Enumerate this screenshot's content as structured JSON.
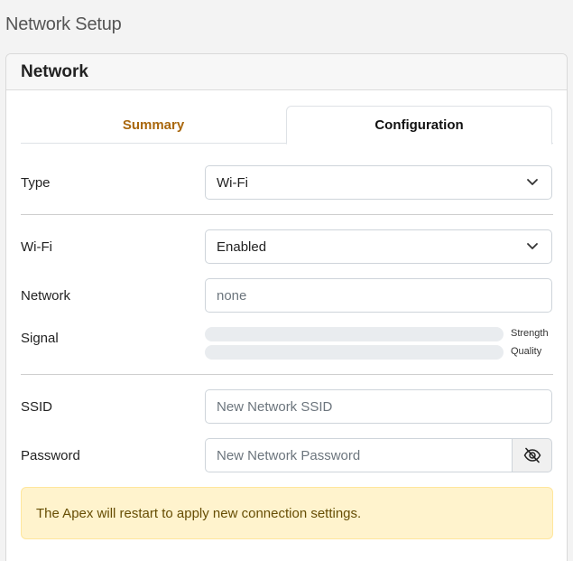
{
  "page": {
    "title": "Network Setup"
  },
  "card": {
    "title": "Network"
  },
  "tabs": [
    {
      "label": "Summary",
      "active": false
    },
    {
      "label": "Configuration",
      "active": true
    }
  ],
  "form": {
    "type": {
      "label": "Type",
      "value": "Wi-Fi"
    },
    "wifi": {
      "label": "Wi-Fi",
      "value": "Enabled"
    },
    "network": {
      "label": "Network",
      "value": "none"
    },
    "signal": {
      "label": "Signal",
      "strength_label": "Strength",
      "quality_label": "Quality",
      "strength": 0,
      "quality": 0
    },
    "ssid": {
      "label": "SSID",
      "placeholder": "New Network SSID"
    },
    "password": {
      "label": "Password",
      "placeholder": "New Network Password"
    }
  },
  "alert": {
    "text": "The Apex will restart to apply new connection settings."
  },
  "colors": {
    "accent_tab": "#a9670d",
    "alert_bg": "#fff3cd",
    "alert_text": "#664d03"
  },
  "icons": {
    "select_caret": "chevron-down-icon",
    "password_toggle": "eye-slash-icon"
  }
}
